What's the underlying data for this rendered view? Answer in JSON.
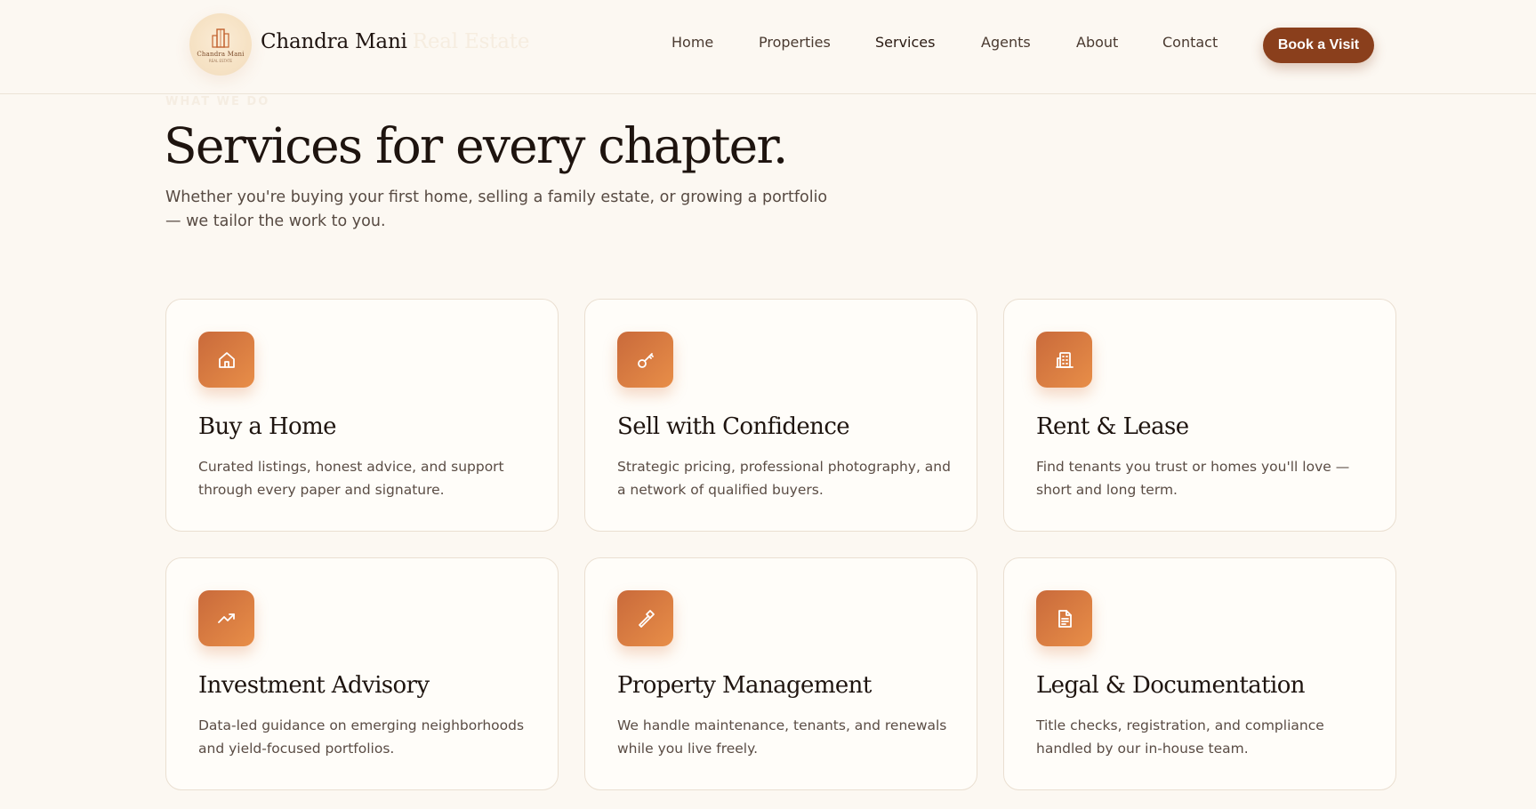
{
  "brand": {
    "name": "Chandra Mani",
    "suffix": "Real Estate",
    "logo_text": "Chandra Mani",
    "logo_subtext": "REAL ESTATE"
  },
  "nav": {
    "items": [
      {
        "label": "Home",
        "icon": null
      },
      {
        "label": "Properties"
      },
      {
        "label": "Services"
      },
      {
        "label": "Agents"
      },
      {
        "label": "About"
      },
      {
        "label": "Contact"
      }
    ],
    "active": "Services",
    "cta_label": "Book a Visit"
  },
  "hero": {
    "eyebrow": "WHAT WE DO",
    "title": "Services for every chapter.",
    "intro": "Whether you're buying your first home, selling a family estate, or growing a portfolio — we tailor the work to you."
  },
  "services": [
    {
      "title": "Buy a Home",
      "desc": "Curated listings, honest advice, and support through every paper and signature.",
      "icon": "home-icon"
    },
    {
      "title": "Sell with Confidence",
      "desc": "Strategic pricing, professional photography, and a network of qualified buyers.",
      "icon": "key-icon"
    },
    {
      "title": "Rent & Lease",
      "desc": "Find tenants you trust or homes you'll love — short and long term.",
      "icon": "building-icon"
    },
    {
      "title": "Investment Advisory",
      "desc": "Data-led guidance on emerging neighborhoods and yield-focused portfolios.",
      "icon": "trending-up-icon"
    },
    {
      "title": "Property Management",
      "desc": "We handle maintenance, tenants, and renewals while you live freely.",
      "icon": "hammer-icon"
    },
    {
      "title": "Legal & Documentation",
      "desc": "Title checks, registration, and compliance handled by our in-house team.",
      "icon": "document-icon"
    }
  ],
  "colors": {
    "background": "#fcf8f2",
    "accent": "#8a3f1c",
    "icon_gradient_start": "#c96a3b",
    "icon_gradient_end": "#e88e48"
  }
}
